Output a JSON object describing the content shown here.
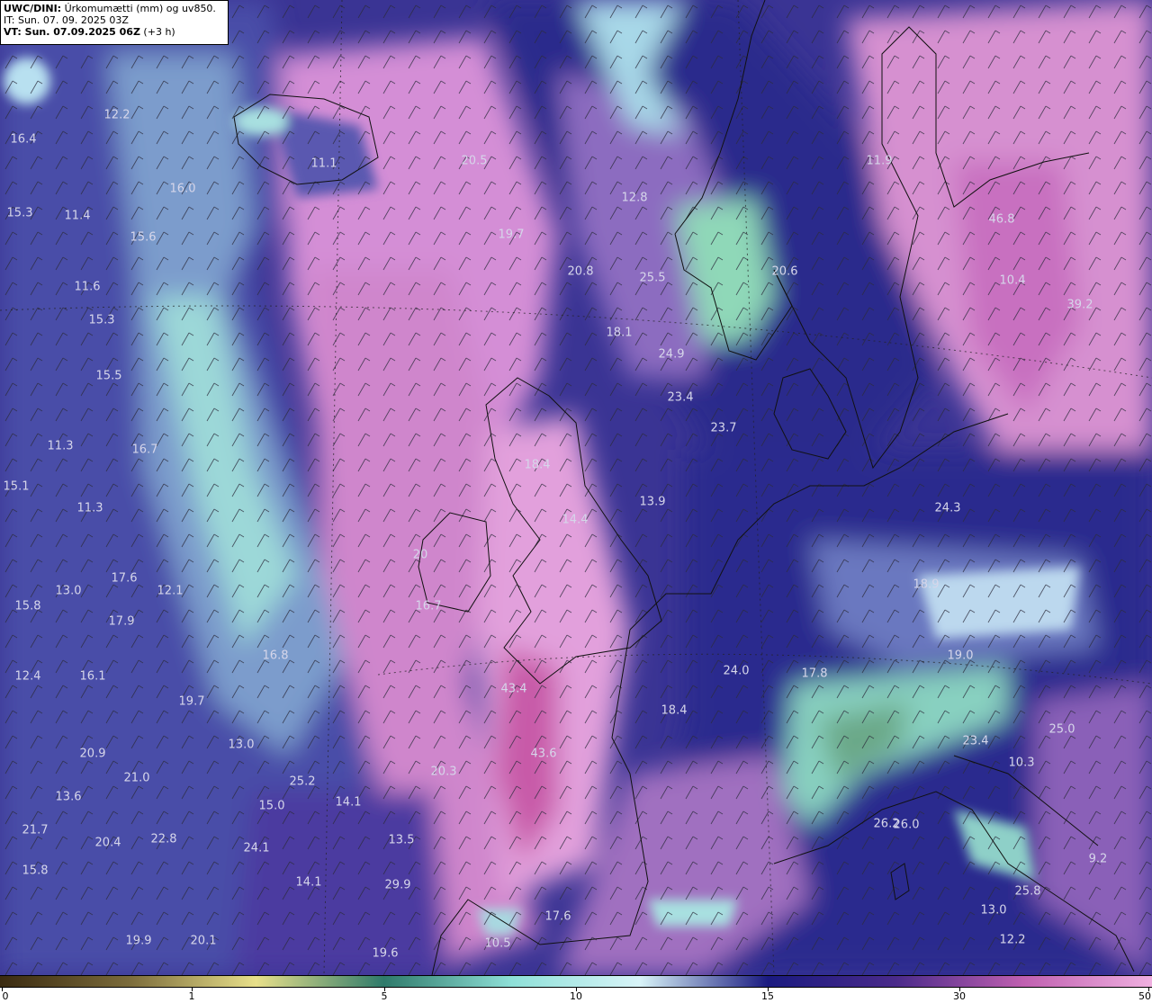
{
  "header": {
    "model": "UWC/DINI:",
    "title": " Úrkomumætti (mm) og uv850.",
    "it_line": "IT: Sun. 07. 09. 2025 03Z",
    "vt_label": "VT: Sun. 07.09.2025 06Z",
    "vt_offset": " (+3 h)"
  },
  "colorbar": {
    "ticks": [
      "0",
      "1",
      "5",
      "10",
      "15",
      "30",
      "50"
    ],
    "colors": [
      "#3a2a10",
      "#7a6a3a",
      "#e8e08a",
      "#2e7a6a",
      "#8ee0d8",
      "#d8f4f8",
      "#1a1a80",
      "#4a2a8a",
      "#c060b0",
      "#f0b0e0"
    ]
  },
  "map_labels": [
    "12.2",
    "16.4",
    "11.1",
    "20.5",
    "16.0",
    "15.3",
    "11.4",
    "15.6",
    "19.7",
    "12.8",
    "20.8",
    "25.5",
    "20.6",
    "11.6",
    "15.3",
    "18.1",
    "24.9",
    "15.5",
    "23.4",
    "23.7",
    "11.3",
    "16.7",
    "18.4",
    "15.1",
    "11.3",
    "13.9",
    "14.4",
    "24.3",
    "20",
    "16.7",
    "17.6",
    "13.0",
    "12.1",
    "15.8",
    "17.9",
    "18.9",
    "16.8",
    "19.0",
    "12.4",
    "16.1",
    "24.0",
    "17.8",
    "19.7",
    "43.4",
    "18.4",
    "13.0",
    "20.9",
    "43.6",
    "25.0",
    "21.0",
    "20.3",
    "23.4",
    "10.3",
    "25.2",
    "13.6",
    "14.1",
    "15.0",
    "21.7",
    "20.4",
    "22.8",
    "24.1",
    "26.2",
    "9.2",
    "15.8",
    "14.1",
    "29.9",
    "17.6",
    "25.8",
    "13.0",
    "19.9",
    "20.1",
    "19.6",
    "10.5",
    "46.8",
    "10.4",
    "39.2",
    "11.9",
    "26.0",
    "12.2",
    "13.5"
  ]
}
